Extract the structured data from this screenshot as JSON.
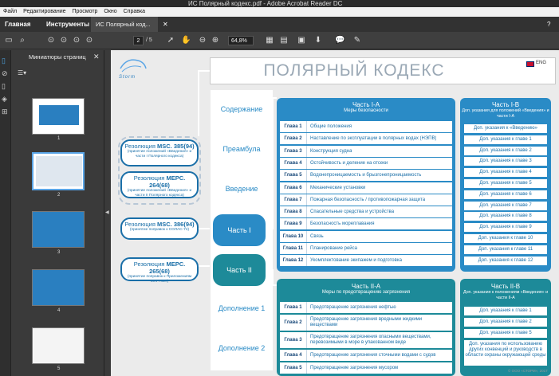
{
  "window": {
    "title": "ИС Полярный кодекс.pdf - Adobe Acrobat Reader DC"
  },
  "menu": [
    "Файл",
    "Редактирование",
    "Просмотр",
    "Окно",
    "Справка"
  ],
  "tabs": {
    "home": "Главная",
    "tools": "Инструменты",
    "document": "ИС Полярный код..."
  },
  "toolbar": {
    "page_current": "2",
    "page_total": "/ 5",
    "zoom": "64,8%"
  },
  "sidebar": {
    "title": "Миниатюры страниц",
    "thumbnails": [
      "1",
      "2",
      "3",
      "4",
      "5"
    ]
  },
  "doc": {
    "title": "ПОЛЯРНЫЙ КОДЕКС",
    "lang": "ENG",
    "logo": "Storm",
    "nav": [
      "Содержание",
      "Преамбула",
      "Введение",
      "Часть I",
      "Часть II",
      "Дополнение 1",
      "Дополнение 2"
    ],
    "resolutions": [
      {
        "name": "Резолюция",
        "code": "MSC. 385(94)",
        "sub": "(принятие положений «Введения» и части I Полярного кодекса)"
      },
      {
        "name": "Резолюция",
        "code": "MEPC. 264(68)",
        "sub": "(принятие положений «Введения» и части II Полярного кодекса)"
      },
      {
        "name": "Резолюция",
        "code": "MSC. 386(94)",
        "sub": "(принятие поправок к СОЛАС-74)"
      },
      {
        "name": "Резолюция",
        "code": "MEPC. 265(68)",
        "sub": "(принятие поправок к Приложениям МАРПОЛ)"
      }
    ],
    "part1a": {
      "title": "Часть I-A",
      "subtitle": "Меры безопасности",
      "rows": [
        {
          "g": "Глава 1",
          "t": "Общие положения"
        },
        {
          "g": "Глава 2",
          "t": "Наставление по эксплуатации в полярных водах (НЭПВ)"
        },
        {
          "g": "Глава 3",
          "t": "Конструкция судна"
        },
        {
          "g": "Глава 4",
          "t": "Остойчивость и деление на отсеки"
        },
        {
          "g": "Глава 5",
          "t": "Водонепроницаемость и брызгонепроницаемость"
        },
        {
          "g": "Глава 6",
          "t": "Механические установки"
        },
        {
          "g": "Глава 7",
          "t": "Пожарная безопасность / противопожарная защита"
        },
        {
          "g": "Глава 8",
          "t": "Спасательные средства и устройства"
        },
        {
          "g": "Глава 9",
          "t": "Безопасность мореплавания"
        },
        {
          "g": "Глава 10",
          "t": "Связь"
        },
        {
          "g": "Глава 11",
          "t": "Планирование рейса"
        },
        {
          "g": "Глава 12",
          "t": "Укомплектование экипажем и подготовка"
        }
      ]
    },
    "part1b": {
      "title": "Часть I-B",
      "subtitle": "Доп. указания для положений «Введения» и части I-A",
      "rows": [
        "Доп. указания к «Введению»",
        "Доп. указания к главе 1",
        "Доп. указания к главе 2",
        "Доп. указания к главе 3",
        "Доп. указания к главе 4",
        "Доп. указания к главе 5",
        "Доп. указания к главе 6",
        "Доп. указания к главе 7",
        "Доп. указания к главе 8",
        "Доп. указания к главе 9",
        "Доп. указания к главе 10",
        "Доп. указания к главе 11",
        "Доп. указания к главе 12"
      ]
    },
    "part2a": {
      "title": "Часть II-A",
      "subtitle": "Меры по предотвращению загрязнения",
      "rows": [
        {
          "g": "Глава 1",
          "t": "Предотвращение загрязнения нефтью"
        },
        {
          "g": "Глава 2",
          "t": "Предотвращение загрязнения вредными жидкими веществами"
        },
        {
          "g": "Глава 3",
          "t": "Предотвращение загрязнения опасными веществами, перевозимыми в море в упакованном виде"
        },
        {
          "g": "Глава 4",
          "t": "Предотвращение загрязнения сточными водами с судов"
        },
        {
          "g": "Глава 5",
          "t": "Предотвращение загрязнения мусором"
        }
      ]
    },
    "part2b": {
      "title": "Часть II-B",
      "subtitle": "Доп. указания к положениям «Введения» и части II-A",
      "rows": [
        "Доп. указания к главе 1",
        "Доп. указания к главе 2",
        "Доп. указания к главе 5",
        "Доп. указания по использованию других конвенций и руководств в области охраны окружающей среды"
      ]
    },
    "copyright": "© ООО «СТОРМ», 2017"
  }
}
